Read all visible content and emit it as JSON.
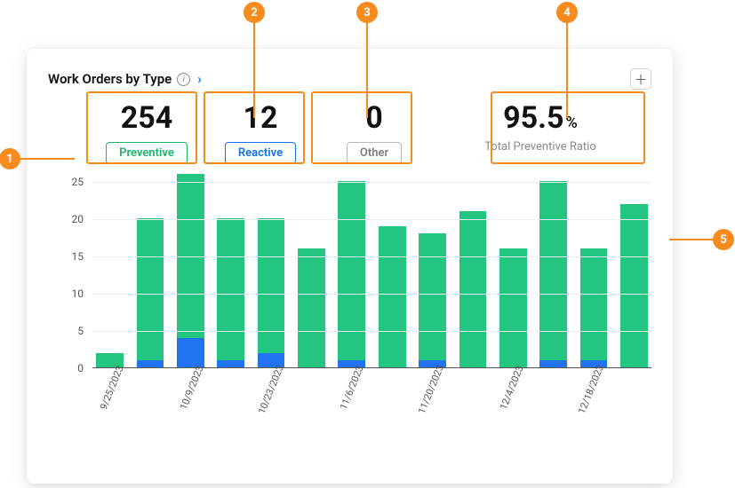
{
  "header": {
    "title": "Work Orders by Type",
    "info_icon": "i",
    "chevron": "›",
    "add_btn": "＋"
  },
  "stats": {
    "preventive": {
      "value": "254",
      "label": "Preventive"
    },
    "reactive": {
      "value": "12",
      "label": "Reactive"
    },
    "other": {
      "value": "0",
      "label": "Other"
    },
    "ratio": {
      "value": "95.5",
      "pct": "%",
      "label": "Total Preventive Ratio"
    }
  },
  "chart_data": {
    "type": "bar",
    "stacked": true,
    "ylabel": "",
    "xlabel": "",
    "ylim": [
      0,
      25
    ],
    "y_ticks": [
      0,
      5,
      10,
      15,
      20,
      25
    ],
    "categories": [
      "9/25/2023",
      "",
      "10/9/2023",
      "",
      "10/23/2023",
      "",
      "11/6/2023",
      "",
      "11/20/2023",
      "",
      "12/4/2023",
      "",
      "12/18/2023",
      ""
    ],
    "series": [
      {
        "name": "Preventive",
        "color": "#23c580",
        "values": [
          2,
          19,
          22,
          19,
          18,
          16,
          24,
          19,
          17,
          21,
          16,
          24,
          15,
          22
        ]
      },
      {
        "name": "Reactive",
        "color": "#2173f2",
        "values": [
          0,
          1,
          4,
          1,
          2,
          0,
          1,
          0,
          1,
          0,
          0,
          1,
          1,
          0
        ]
      }
    ],
    "totals": [
      2,
      20,
      26,
      20,
      20,
      16,
      25,
      19,
      18,
      21,
      16,
      25,
      16,
      22
    ]
  },
  "callouts": [
    "1",
    "2",
    "3",
    "4",
    "5"
  ]
}
